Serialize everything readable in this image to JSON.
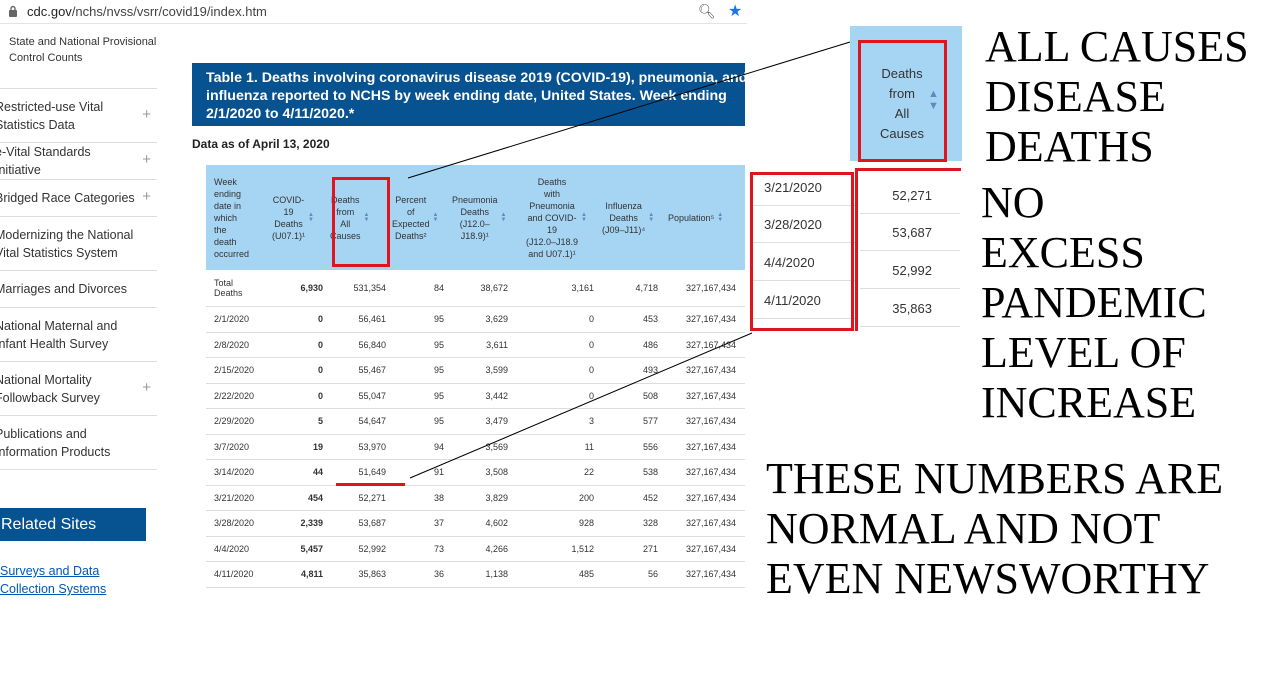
{
  "browser": {
    "url_host": "cdc.gov",
    "url_path": "/nchs/nvss/vsrr/covid19/index.htm"
  },
  "sidebar": {
    "sub_item": "State and National Provisional Control Counts",
    "items": [
      {
        "label": "Restricted-use Vital Statistics Data",
        "expandable": true
      },
      {
        "label": "e-Vital Standards Initiative",
        "expandable": true
      },
      {
        "label": "Bridged Race Categories",
        "expandable": true
      },
      {
        "label": "Modernizing the National Vital Statistics System",
        "expandable": false
      },
      {
        "label": "Marriages and Divorces",
        "expandable": false
      },
      {
        "label": "National Maternal and Infant Health Survey",
        "expandable": false
      },
      {
        "label": "National Mortality Followback Survey",
        "expandable": true
      },
      {
        "label": "Publications and Information Products",
        "expandable": false
      }
    ],
    "related_title": "Related Sites",
    "related_links": [
      "Surveys and Data",
      "Collection Systems"
    ]
  },
  "table": {
    "title": "Table 1. Deaths involving coronavirus disease 2019 (COVID-19), pneumonia, and influenza reported to NCHS by week ending date, United States. Week ending 2/1/2020 to 4/11/2020.*",
    "title_lines": [
      "Table 1. Deaths involving coronavirus disease 2019 (COVID-19), pneumonia, and",
      "influenza reported to NCHS by week ending date, United States. Week ending",
      "2/1/2020 to 4/11/2020.*"
    ],
    "as_of": "Data as of April 13, 2020",
    "columns": [
      {
        "lines": [
          "Week",
          "ending",
          "date in",
          "which",
          "the",
          "death",
          "occurred"
        ]
      },
      {
        "lines": [
          "COVID-",
          "19",
          "Deaths",
          "(U07.1)¹"
        ]
      },
      {
        "lines": [
          "Deaths",
          "from",
          "All",
          "Causes"
        ]
      },
      {
        "lines": [
          "Percent",
          "of",
          "Expected",
          "Deaths²"
        ]
      },
      {
        "lines": [
          "Pneumonia",
          "Deaths",
          "(J12.0–",
          "J18.9)¹"
        ]
      },
      {
        "lines": [
          "Deaths",
          "with",
          "Pneumonia",
          "and COVID-",
          "19",
          "(J12.0–J18.9",
          "and U07.1)¹"
        ]
      },
      {
        "lines": [
          "Influenza",
          "Deaths",
          "(J09–J11)⁴"
        ]
      },
      {
        "lines": [
          "Population⁵"
        ]
      }
    ],
    "rows": [
      [
        "Total Deaths",
        "6,930",
        "531,354",
        "84",
        "38,672",
        "3,161",
        "4,718",
        "327,167,434"
      ],
      [
        "2/1/2020",
        "0",
        "56,461",
        "95",
        "3,629",
        "0",
        "453",
        "327,167,434"
      ],
      [
        "2/8/2020",
        "0",
        "56,840",
        "95",
        "3,611",
        "0",
        "486",
        "327,167,434"
      ],
      [
        "2/15/2020",
        "0",
        "55,467",
        "95",
        "3,599",
        "0",
        "493",
        "327,167,434"
      ],
      [
        "2/22/2020",
        "0",
        "55,047",
        "95",
        "3,442",
        "0",
        "508",
        "327,167,434"
      ],
      [
        "2/29/2020",
        "5",
        "54,647",
        "95",
        "3,479",
        "3",
        "577",
        "327,167,434"
      ],
      [
        "3/7/2020",
        "19",
        "53,970",
        "94",
        "3,569",
        "11",
        "556",
        "327,167,434"
      ],
      [
        "3/14/2020",
        "44",
        "51,649",
        "91",
        "3,508",
        "22",
        "538",
        "327,167,434"
      ],
      [
        "3/21/2020",
        "454",
        "52,271",
        "38",
        "3,829",
        "200",
        "452",
        "327,167,434"
      ],
      [
        "3/28/2020",
        "2,339",
        "53,687",
        "37",
        "4,602",
        "928",
        "328",
        "327,167,434"
      ],
      [
        "4/4/2020",
        "5,457",
        "52,992",
        "73",
        "4,266",
        "1,512",
        "271",
        "327,167,434"
      ],
      [
        "4/11/2020",
        "4,811",
        "35,863",
        "36",
        "1,138",
        "485",
        "56",
        "327,167,434"
      ]
    ]
  },
  "zoom": {
    "header_lines": [
      "Deaths",
      "from",
      "All",
      "Causes"
    ],
    "rows": [
      {
        "date": "3/21/2020",
        "value": "52,271"
      },
      {
        "date": "3/28/2020",
        "value": "53,687"
      },
      {
        "date": "4/4/2020",
        "value": "52,992"
      },
      {
        "date": "4/11/2020",
        "value": "35,863"
      }
    ]
  },
  "annotations": {
    "all_causes": [
      "ALL CAUSES",
      "DISEASE",
      "DEATHS"
    ],
    "no_excess": [
      "NO",
      "EXCESS",
      "PANDEMIC",
      "LEVEL OF",
      "INCREASE"
    ],
    "normal": [
      "THESE NUMBERS ARE",
      "NORMAL AND NOT",
      "EVEN NEWSWORTHY"
    ]
  },
  "colors": {
    "brand_blue": "#075290",
    "header_blue": "#a6d4f3",
    "highlight_red": "#e0141c",
    "link_blue": "#0057b8"
  }
}
